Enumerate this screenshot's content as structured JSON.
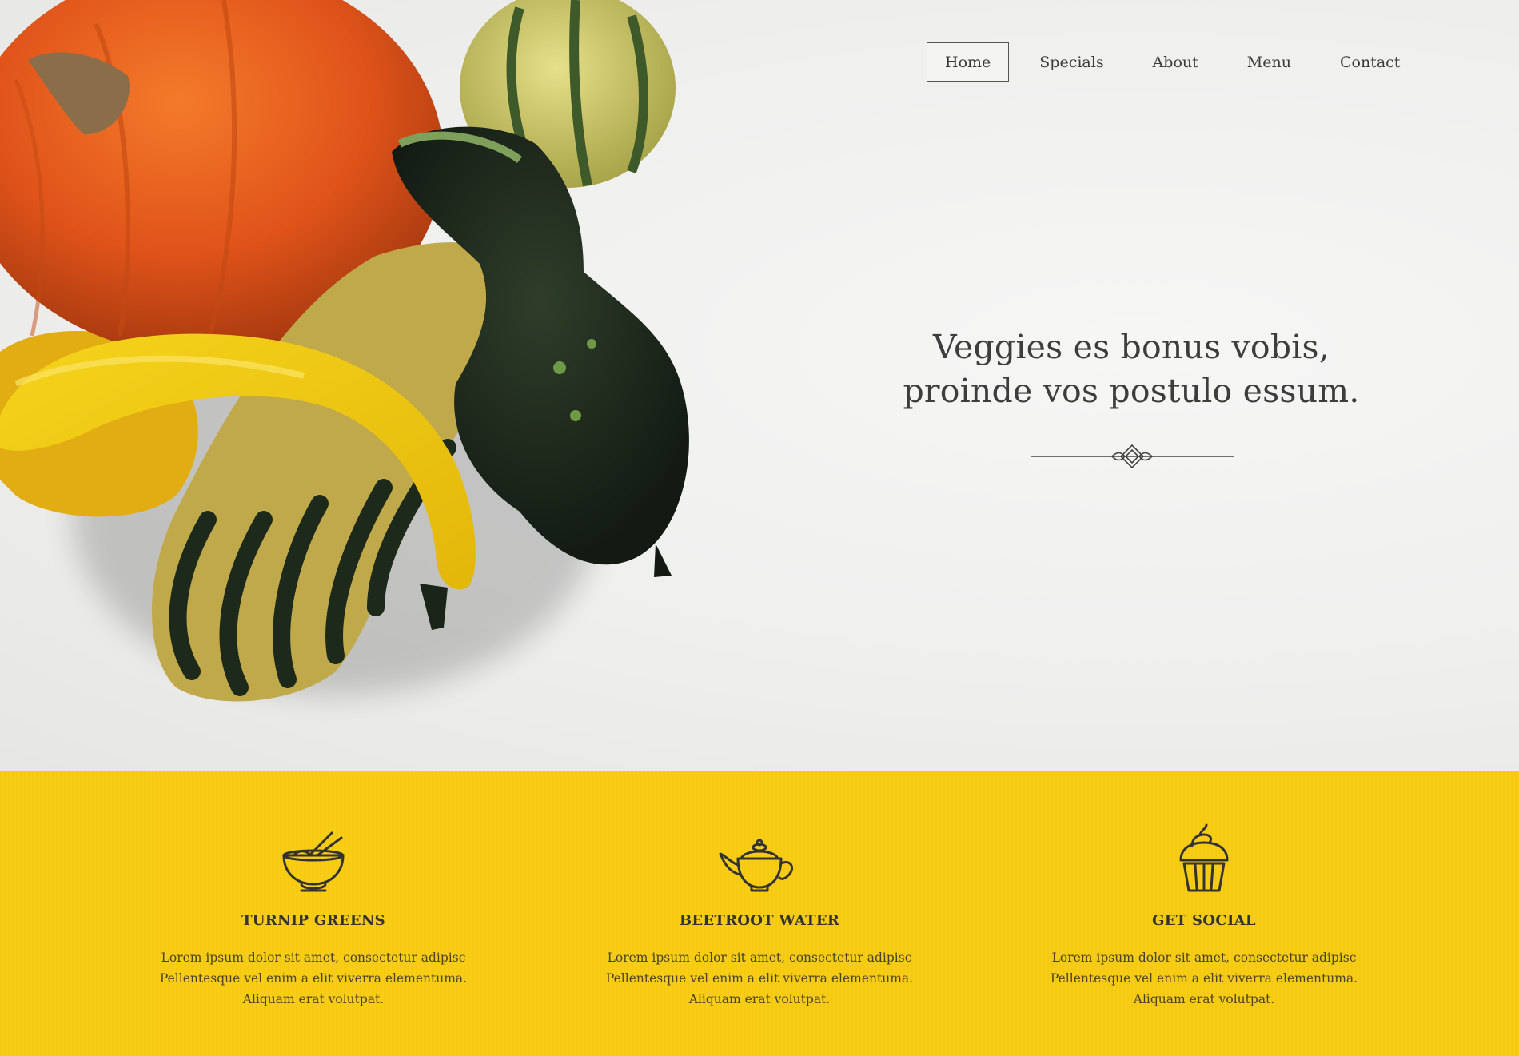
{
  "nav": {
    "items": [
      {
        "label": "Home",
        "active": true
      },
      {
        "label": "Specials",
        "active": false
      },
      {
        "label": "About",
        "active": false
      },
      {
        "label": "Menu",
        "active": false
      },
      {
        "label": "Contact",
        "active": false
      }
    ]
  },
  "hero": {
    "headline_line1": "Veggies es bonus vobis,",
    "headline_line2": "proinde vos postulo essum.",
    "image": "squash-and-pumpkins-photo"
  },
  "features": [
    {
      "icon": "noodle-bowl-icon",
      "title": "TURNIP GREENS",
      "lines": [
        "Lorem ipsum dolor sit amet, consectetur adipisc",
        "Pellentesque vel enim a elit viverra elementuma.",
        "Aliquam erat volutpat."
      ]
    },
    {
      "icon": "teapot-icon",
      "title": "BEETROOT WATER",
      "lines": [
        "Lorem ipsum dolor sit amet, consectetur adipisc",
        "Pellentesque vel enim a elit viverra elementuma.",
        "Aliquam erat volutpat."
      ]
    },
    {
      "icon": "cupcake-icon",
      "title": "GET SOCIAL",
      "lines": [
        "Lorem ipsum dolor sit amet, consectetur adipisc",
        "Pellentesque vel enim a elit viverra elementuma.",
        "Aliquam erat volutpat."
      ]
    }
  ],
  "colors": {
    "band": "#f8cd14",
    "hero_bg": "#f1f1f0",
    "text": "#3a3a3a",
    "pumpkin": "#e8571c",
    "squash_yellow": "#f3cc12",
    "squash_green": "#1f2a1e"
  }
}
